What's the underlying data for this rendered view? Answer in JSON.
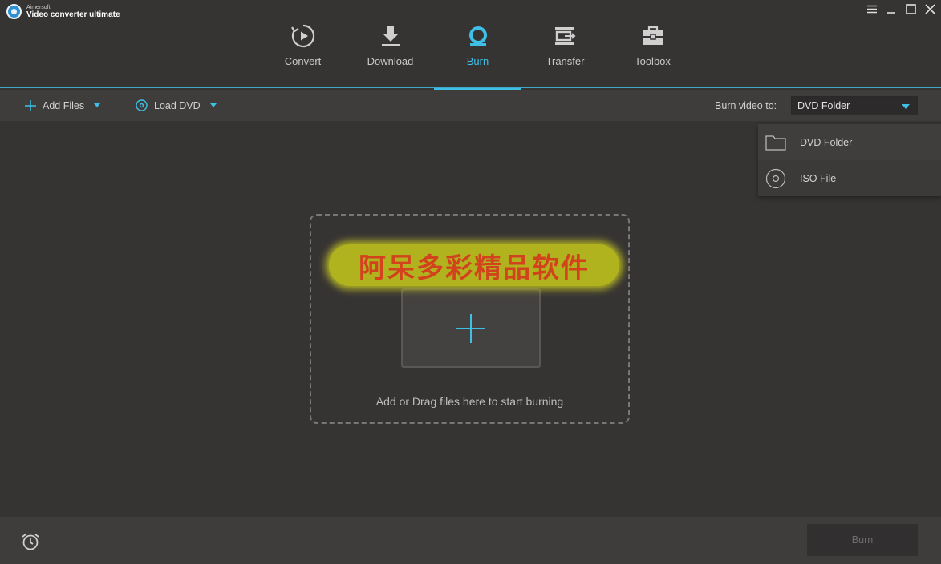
{
  "app": {
    "brand": "Aimersoft",
    "product": "Video converter ultimate"
  },
  "window_controls": {
    "menu_icon": "hamburger-icon",
    "minimize_icon": "minimize-icon",
    "maximize_icon": "maximize-icon",
    "close_icon": "close-icon"
  },
  "nav": {
    "tabs": [
      {
        "label": "Convert",
        "icon": "convert-icon"
      },
      {
        "label": "Download",
        "icon": "download-icon"
      },
      {
        "label": "Burn",
        "icon": "burn-disc-icon",
        "active": true
      },
      {
        "label": "Transfer",
        "icon": "transfer-icon"
      },
      {
        "label": "Toolbox",
        "icon": "toolbox-icon"
      }
    ]
  },
  "toolbar": {
    "add_files": "Add Files",
    "load_dvd": "Load DVD",
    "burn_to_label": "Burn video to:",
    "burn_to_value": "DVD Folder"
  },
  "dropdown": {
    "items": [
      {
        "label": "DVD Folder",
        "icon": "folder-icon"
      },
      {
        "label": "ISO File",
        "icon": "disc-icon"
      }
    ]
  },
  "dropzone": {
    "hint": "Add or Drag files here to start burning"
  },
  "watermark": {
    "text": "阿呆多彩精品软件"
  },
  "footer": {
    "burn_button": "Burn",
    "alarm_icon": "alarm-clock-icon"
  },
  "colors": {
    "accent": "#3ec0e6",
    "background": "#363333",
    "toolbar": "#3f3c3c"
  }
}
